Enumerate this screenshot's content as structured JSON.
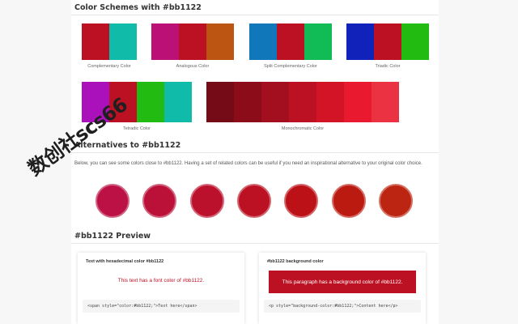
{
  "colors": {
    "base": "#bb1122",
    "page_background": "#f7f7f7",
    "rule": "#e6e6e6"
  },
  "section_schemes": {
    "title": "Color Schemes with #bb1122",
    "schemes": [
      {
        "label": "Complementary Color",
        "swatches": [
          "#bb1122",
          "#11bbaa"
        ]
      },
      {
        "label": "Analogous Color",
        "swatches": [
          "#bb1177",
          "#bb1122",
          "#bb5511"
        ]
      },
      {
        "label": "Split Complementary Color",
        "swatches": [
          "#1177bb",
          "#bb1122",
          "#11bb55"
        ]
      },
      {
        "label": "Triadic Color",
        "swatches": [
          "#1122bb",
          "#bb1122",
          "#22bb11"
        ]
      },
      {
        "label": "Tetradic Color",
        "swatches": [
          "#aa11bb",
          "#bb1122",
          "#22bb11",
          "#11bbaa"
        ]
      },
      {
        "label": "Monochromatic Color",
        "swatches": [
          "#750b16",
          "#8c0d19",
          "#a30f1e",
          "#bb1122",
          "#d31326",
          "#e91a2f",
          "#eb3243"
        ]
      }
    ]
  },
  "section_alternatives": {
    "title": "Alternatives to #bb1122",
    "description": "Below, you can see some colors close to #bb1122. Having a set of related colors can be useful if you need an inspirational alternative to your original color choice.",
    "circles": [
      "#bb1144",
      "#bb1138",
      "#bb112d",
      "#bb1122",
      "#bb1117",
      "#bb1a11",
      "#bb2511"
    ]
  },
  "section_preview": {
    "title": "#bb1122 Preview",
    "text_card": {
      "title": "Text with hexadecimal color #bb1122",
      "sample": "This text has a font color of #bb1122.",
      "code": "<span style=\"color:#bb1122;\">Text here</span>"
    },
    "bg_card": {
      "title": "#bb1122 background color",
      "sample": "This paragraph has a background color of #bb1122.",
      "code": "<p style=\"background-color:#bb1122;\">Content here</p>"
    }
  },
  "watermark": {
    "text": "数创社scs66",
    "color": "#1f1f1f"
  }
}
